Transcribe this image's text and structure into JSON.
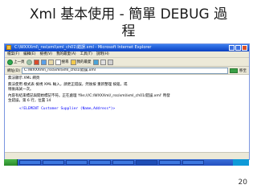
{
  "slide": {
    "title_line1": "Xml 基本使用 - 簡單 DEBUG 過",
    "title_line2": "程",
    "page_number": "20"
  },
  "browser": {
    "window_title": "C:\\WXXXml\\_rss\\xml\\xml_ch01\\錯誤.xml - Microsoft Internet Explorer",
    "menu_items": [
      "檔案(F)",
      "編輯(E)",
      "檢視(V)",
      "我的最愛(A)",
      "工具(T)",
      "說明(H)"
    ],
    "toolbar": {
      "back_label": "上一頁",
      "search_label": "搜尋",
      "favorites_label": "我的最愛"
    },
    "address": {
      "label": "網址(D)",
      "value": "C:\\WXXXml\\_rss\\xml\\xml_ch01\\錯誤.xml",
      "go_label": "移至"
    },
    "content": {
      "line1": "無法顯示 XML 網頁",
      "line2": "無法使用 樣式表 檢視 XML 輸入，請更正錯誤，然後按 重新整理 按鈕，或",
      "line3": "稍後再試一次。",
      "error_line1": "內容有結束標記與開始標記不符。正在處理 'file:///C:/WXXXml/_rss/xml/xml_ch01/錯誤.xml' 時發",
      "error_line2": "生錯誤，第 6 行，位置 14",
      "code_line": "<!ELEMENT Customer Supplier (Name,Address*)>"
    },
    "statusbar": ""
  },
  "taskbar": {
    "items": [
      "",
      "",
      "",
      "",
      "",
      "",
      "",
      "",
      ""
    ]
  }
}
